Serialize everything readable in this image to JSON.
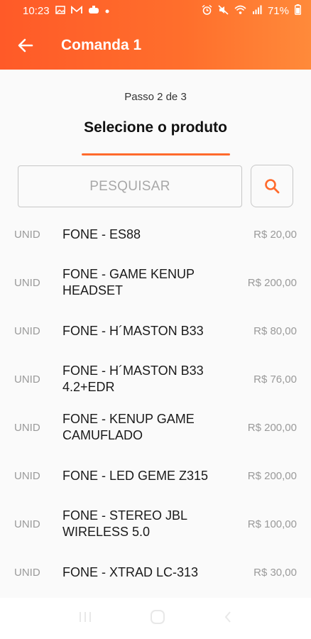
{
  "status_bar": {
    "time": "10:23",
    "battery": "71%",
    "icons_left": [
      "image-icon",
      "m-icon",
      "game-icon",
      "dot-icon"
    ],
    "icons_right": [
      "alarm-icon",
      "mute-icon",
      "wifi-icon",
      "signal-icon",
      "battery-icon"
    ]
  },
  "app_bar": {
    "title": "Comanda 1"
  },
  "step": {
    "label": "Passo 2 de 3",
    "heading": "Selecione o produto"
  },
  "search": {
    "placeholder": "PESQUISAR",
    "value": ""
  },
  "products": [
    {
      "unit": "UNID",
      "name": "FONE - ES88",
      "price": "R$ 20,00"
    },
    {
      "unit": "UNID",
      "name": "FONE - GAME KENUP HEADSET",
      "price": "R$ 200,00"
    },
    {
      "unit": "UNID",
      "name": "FONE - H´MASTON B33",
      "price": "R$ 80,00"
    },
    {
      "unit": "UNID",
      "name": "FONE - H´MASTON B33 4.2+EDR",
      "price": "R$ 76,00"
    },
    {
      "unit": "UNID",
      "name": "FONE - KENUP GAME CAMUFLADO",
      "price": "R$ 200,00"
    },
    {
      "unit": "UNID",
      "name": "FONE - LED GEME Z315",
      "price": "R$ 200,00"
    },
    {
      "unit": "UNID",
      "name": "FONE - STEREO JBL WIRELESS 5.0",
      "price": "R$ 100,00"
    },
    {
      "unit": "UNID",
      "name": "FONE - XTRAD LC-313",
      "price": "R$ 30,00"
    }
  ],
  "colors": {
    "accent": "#ff6a2c",
    "muted_text": "#9a9a9a"
  }
}
